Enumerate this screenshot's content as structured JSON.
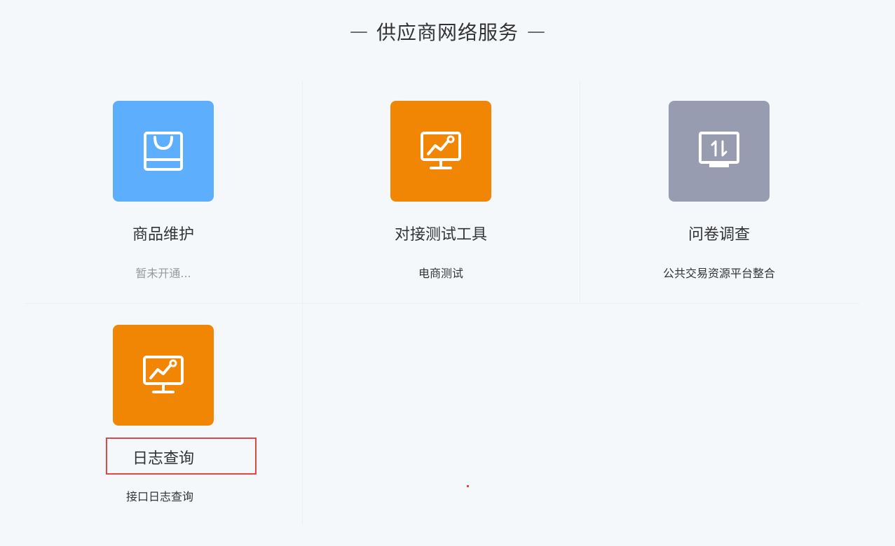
{
  "header": {
    "title": "供应商网络服务",
    "dash": "—"
  },
  "colors": {
    "blue": "#5daefc",
    "orange": "#f08604",
    "gray": "#989cb0",
    "highlight": "#e04848"
  },
  "cards": [
    {
      "title": "商品维护",
      "desc": "暂未开通...",
      "icon": "shopping-bag-icon",
      "color": "#5daefc",
      "disabled": true
    },
    {
      "title": "对接测试工具",
      "desc": "电商测试",
      "icon": "monitor-chart-icon",
      "color": "#f08604"
    },
    {
      "title": "问卷调查",
      "desc": "公共交易资源平台整合",
      "icon": "monitor-transfer-icon",
      "color": "#989cb0"
    },
    {
      "title": "日志查询",
      "desc": "接口日志查询",
      "icon": "monitor-chart-icon",
      "color": "#f08604",
      "highlighted": true
    }
  ]
}
